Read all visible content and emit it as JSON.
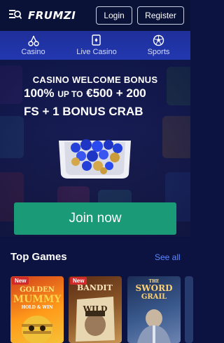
{
  "header": {
    "logo": "FRUMZI",
    "login_label": "Login",
    "register_label": "Register"
  },
  "nav": {
    "items": [
      {
        "label": "Casino",
        "icon": "cherries-icon"
      },
      {
        "label": "Live Casino",
        "icon": "cards-icon"
      },
      {
        "label": "Sports",
        "icon": "soccer-ball-icon"
      }
    ]
  },
  "hero": {
    "heading": "CASINO WELCOME BONUS",
    "line2_main": "100%",
    "line2_up": "UP TO",
    "line2_rest": "€500 + 200",
    "line3": "FS + 1 BONUS CRAB",
    "join_label": "Join now"
  },
  "top_games": {
    "title": "Top Games",
    "see_all": "See all",
    "games": [
      {
        "badge": "New",
        "title_top": "GOLDEN",
        "title_main": "MUMMY",
        "subtitle": "HOLD & WIN"
      },
      {
        "badge": "New",
        "title_top": "BANDIT",
        "title_main": "WILD",
        "subtitle": ""
      },
      {
        "badge": "",
        "title_top": "SWORD",
        "title_main": "GRAIL",
        "subtitle": "THE"
      }
    ]
  },
  "colors": {
    "background": "#0d1340",
    "nav": "#2238b0",
    "join_button": "#1b9a78",
    "link": "#5d86ff"
  }
}
